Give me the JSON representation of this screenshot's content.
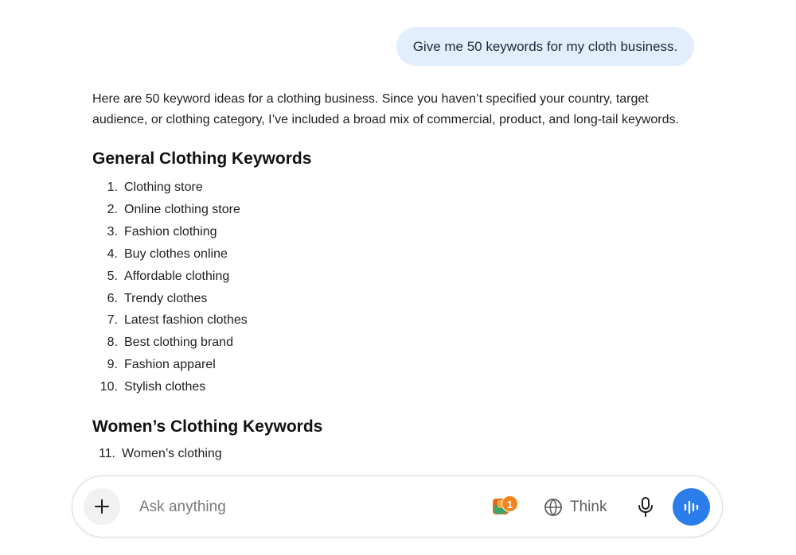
{
  "user_message": "Give me 50 keywords for my cloth business.",
  "response": {
    "intro": "Here are 50 keyword ideas for a clothing business. Since you haven’t specified your country, target audience, or clothing category, I’ve included a broad mix of commercial, product, and long-tail keywords.",
    "sections": [
      {
        "title": "General Clothing Keywords",
        "items": [
          {
            "num": "1.",
            "text": "Clothing store"
          },
          {
            "num": "2.",
            "text": "Online clothing store"
          },
          {
            "num": "3.",
            "text": "Fashion clothing"
          },
          {
            "num": "4.",
            "text": "Buy clothes online"
          },
          {
            "num": "5.",
            "text": "Affordable clothing"
          },
          {
            "num": "6.",
            "text": "Trendy clothes"
          },
          {
            "num": "7.",
            "text": "Latest fashion clothes"
          },
          {
            "num": "8.",
            "text": "Best clothing brand"
          },
          {
            "num": "9.",
            "text": "Fashion apparel"
          },
          {
            "num": "10.",
            "text": "Stylish clothes"
          }
        ]
      },
      {
        "title": "Women’s Clothing Keywords",
        "items": [
          {
            "num": "11.",
            "text": "Women’s clothing"
          }
        ]
      }
    ]
  },
  "composer": {
    "placeholder": "Ask anything",
    "apps_badge": "1",
    "think_label": "Think"
  },
  "icons": {
    "plus": "plus-icon",
    "apps": "apps-icon",
    "think": "globe-icon",
    "mic": "microphone-icon",
    "voice": "voice-mode-icon"
  },
  "colors": {
    "user_bubble": "#e3eefc",
    "voice_button": "#2b7de9",
    "badge": "#f5821f"
  }
}
